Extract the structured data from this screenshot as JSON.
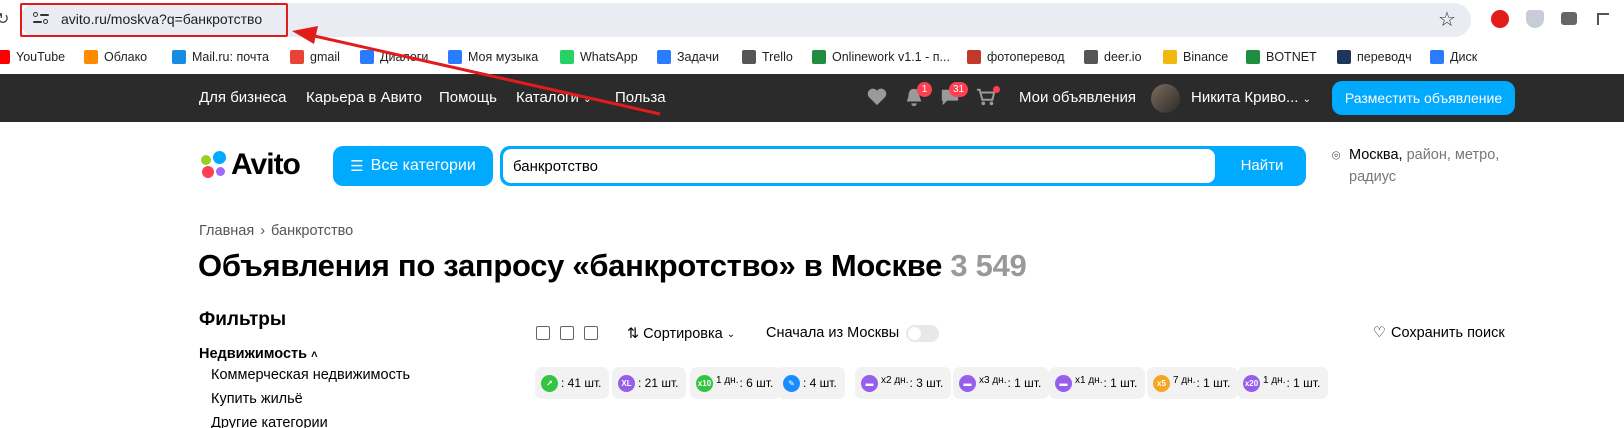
{
  "browser": {
    "url": "avito.ru/moskva?q=банкротство",
    "bookmarks": [
      {
        "label": "YouTube",
        "icon": "youtube-icon",
        "color": "#ff0000"
      },
      {
        "label": "Облако",
        "icon": "cloud-icon",
        "color": "#ff8a00"
      },
      {
        "label": "Mail.ru: почта",
        "icon": "mailru-icon",
        "color": "#168de2"
      },
      {
        "label": "gmail",
        "icon": "gmail-icon",
        "color": "#ea4335"
      },
      {
        "label": "Диалоги",
        "icon": "dialogs-icon",
        "color": "#2a7cff"
      },
      {
        "label": "Моя музыка",
        "icon": "music-icon",
        "color": "#2a7cff"
      },
      {
        "label": "WhatsApp",
        "icon": "whatsapp-icon",
        "color": "#25d366"
      },
      {
        "label": "Задачи",
        "icon": "tasks-icon",
        "color": "#2a7cff"
      },
      {
        "label": "Trello",
        "icon": "trello-icon",
        "color": "#555555"
      },
      {
        "label": "Onlinework v1.1 - п...",
        "icon": "sheets-icon",
        "color": "#1e8e3e"
      },
      {
        "label": "фотоперевод",
        "icon": "photo-translate-icon",
        "color": "#c0392b"
      },
      {
        "label": "deer.io",
        "icon": "cart-icon",
        "color": "#555555"
      },
      {
        "label": "Binance",
        "icon": "binance-icon",
        "color": "#f0b90b"
      },
      {
        "label": "BOTNET",
        "icon": "sheets-icon",
        "color": "#1e8e3e"
      },
      {
        "label": "переводч",
        "icon": "translate-icon",
        "color": "#1d3557"
      },
      {
        "label": "Диск",
        "icon": "disk-icon",
        "color": "#2a7cff"
      }
    ]
  },
  "topbar": {
    "nav": [
      "Для бизнеса",
      "Карьера в Авито",
      "Помощь",
      "Каталоги",
      "Польза"
    ],
    "notifications_badge": "1",
    "messages_badge": "31",
    "my_ads": "Мои объявления",
    "user_name": "Никита Криво...",
    "place_ad": "Разместить объявление"
  },
  "header": {
    "logo_text": "Avito",
    "all_categories": "Все категории",
    "search_value": "банкротство",
    "search_button": "Найти",
    "location_primary": "Москва,",
    "location_secondary_1": "район, метро,",
    "location_secondary_2": "радиус"
  },
  "breadcrumb": {
    "home": "Главная",
    "current": "банкротство"
  },
  "page": {
    "title": "Объявления по запросу «банкротство» в Москве",
    "count": "3 549"
  },
  "filters": {
    "title": "Фильтры",
    "group": "Недвижимость",
    "items": [
      "Коммерческая недвижимость",
      "Купить жильё",
      "Другие категории"
    ]
  },
  "toolbar": {
    "sort_label": "Сортировка",
    "from_moscow": "Сначала из Москвы",
    "save_search": "Сохранить поиск"
  },
  "chips": [
    {
      "sup": "",
      "text": ": 41 шт.",
      "icon": "arrow-up-icon",
      "color": "#33c443",
      "glyph": "↗"
    },
    {
      "sup": "",
      "text": ": 21 шт.",
      "icon": "xl-icon",
      "color": "#965eeb",
      "glyph": "XL"
    },
    {
      "sup": "1 дн.",
      "text": ": 6 шт.",
      "icon": "x10-icon",
      "color": "#33c443",
      "glyph": "x10"
    },
    {
      "sup": "",
      "text": ": 4 шт.",
      "icon": "highlight-icon",
      "color": "#1a8cff",
      "glyph": "✎"
    },
    {
      "sup": "x2 дн.",
      "text": ": 3 шт.",
      "icon": "x2-icon",
      "color": "#965eeb",
      "glyph": "▬"
    },
    {
      "sup": "x3 дн.",
      "text": ": 1 шт.",
      "icon": "x3-icon",
      "color": "#965eeb",
      "glyph": "▬"
    },
    {
      "sup": "x1 дн.",
      "text": ": 1 шт.",
      "icon": "x1-icon",
      "color": "#965eeb",
      "glyph": "▬"
    },
    {
      "sup": "7 дн.",
      "text": ": 1 шт.",
      "icon": "x5-icon",
      "color": "#f5a623",
      "glyph": "x5"
    },
    {
      "sup": "1 дн.",
      "text": ": 1 шт.",
      "icon": "x20-icon",
      "color": "#965eeb",
      "glyph": "x20"
    }
  ]
}
